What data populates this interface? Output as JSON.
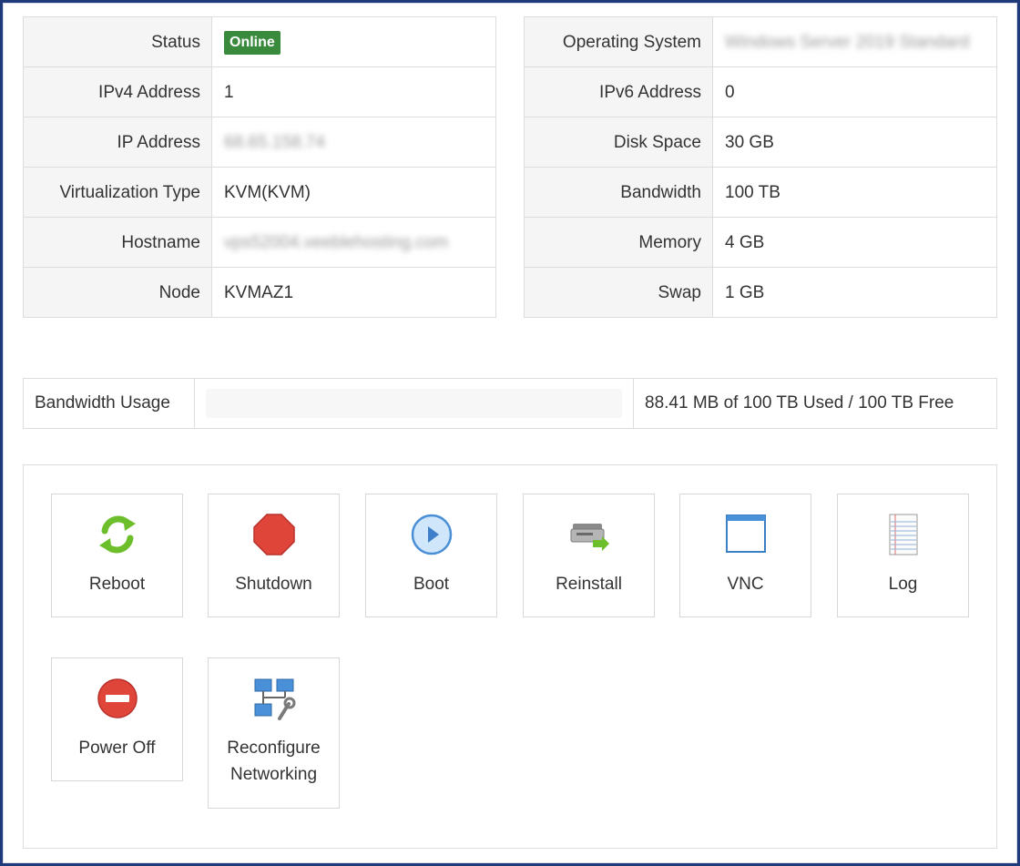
{
  "left_table": [
    {
      "label": "Status",
      "value": "Online"
    },
    {
      "label": "IPv4 Address",
      "value": "1"
    },
    {
      "label": "IP Address",
      "value": "68.65.158.74"
    },
    {
      "label": "Virtualization Type",
      "value": "KVM(KVM)"
    },
    {
      "label": "Hostname",
      "value": "vps52004.veeblehosting.com"
    },
    {
      "label": "Node",
      "value": "KVMAZ1"
    }
  ],
  "right_table": [
    {
      "label": "Operating System",
      "value": "Windows Server 2019 Standard"
    },
    {
      "label": "IPv6 Address",
      "value": "0"
    },
    {
      "label": "Disk Space",
      "value": "30 GB"
    },
    {
      "label": "Bandwidth",
      "value": "100 TB"
    },
    {
      "label": "Memory",
      "value": "4 GB"
    },
    {
      "label": "Swap",
      "value": "1 GB"
    }
  ],
  "status_color": "#3a8a3e",
  "bandwidth": {
    "label": "Bandwidth Usage",
    "used_fraction": 0.0,
    "text": "88.41 MB of 100 TB Used / 100 TB Free"
  },
  "actions": [
    {
      "label": "Reboot",
      "icon": "reboot-icon"
    },
    {
      "label": "Shutdown",
      "icon": "shutdown-icon"
    },
    {
      "label": "Boot",
      "icon": "boot-icon"
    },
    {
      "label": "Reinstall",
      "icon": "reinstall-icon"
    },
    {
      "label": "VNC",
      "icon": "vnc-icon"
    },
    {
      "label": "Log",
      "icon": "log-icon"
    },
    {
      "label": "Power Off",
      "icon": "power-off-icon"
    },
    {
      "label": "Reconfigure Networking",
      "icon": "network-icon"
    }
  ]
}
